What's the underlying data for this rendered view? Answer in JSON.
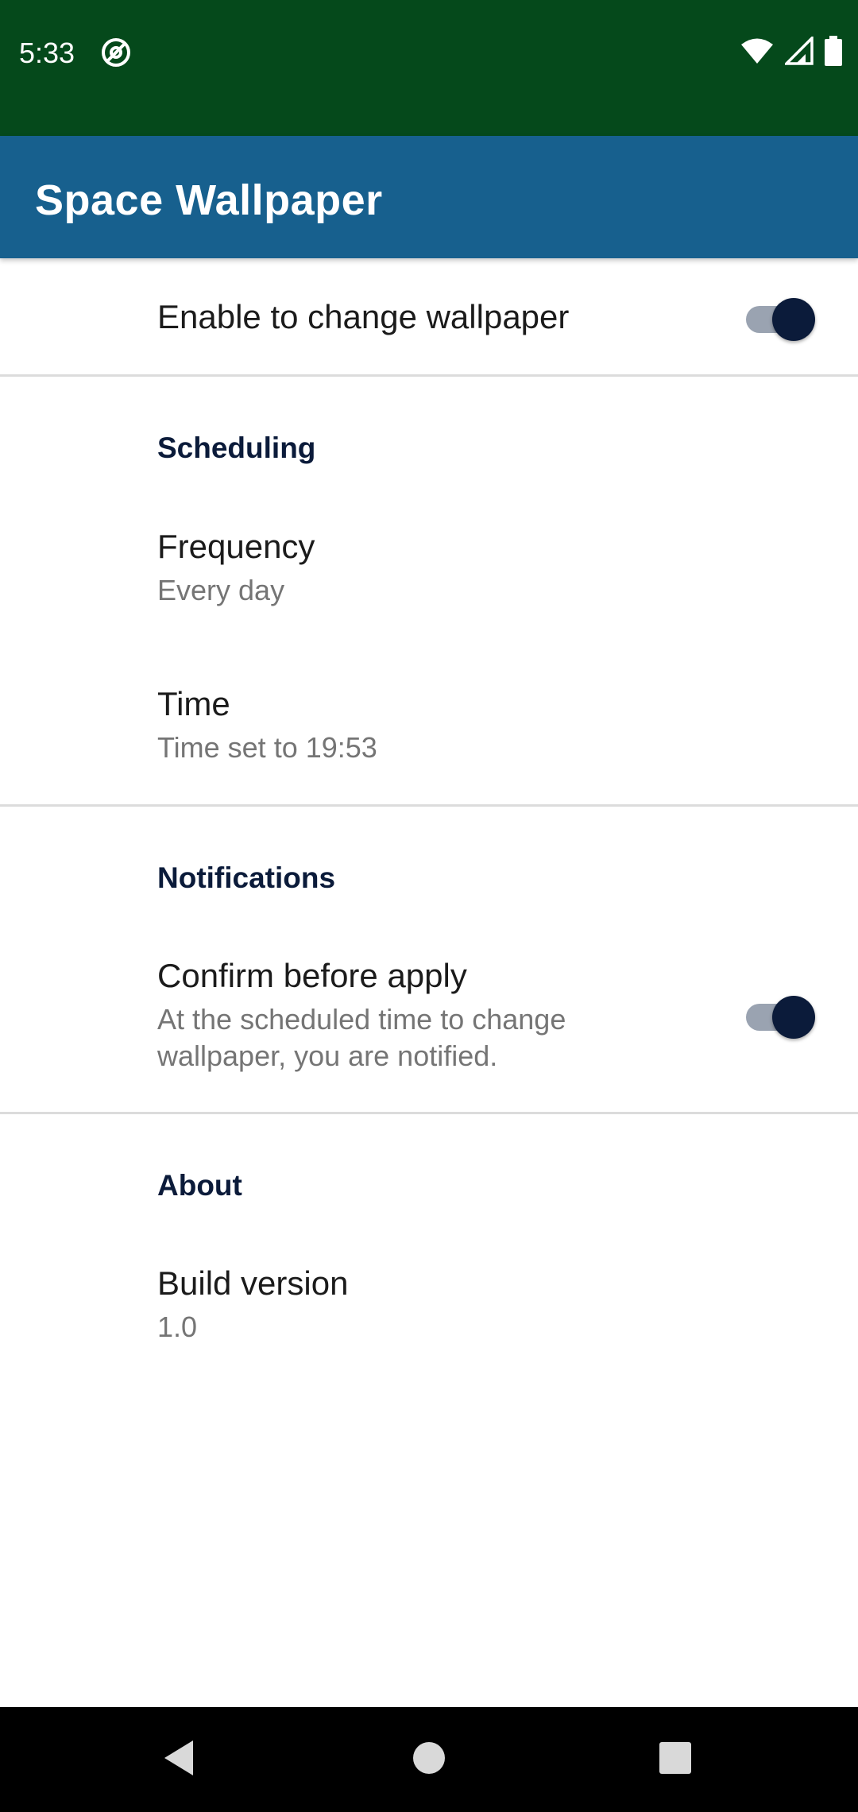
{
  "status_bar": {
    "time": "5:33",
    "icons": [
      "at-sign-icon",
      "wifi-icon",
      "signal-icon",
      "battery-icon"
    ]
  },
  "app_bar": {
    "title": "Space Wallpaper"
  },
  "settings": {
    "enable": {
      "title": "Enable to change wallpaper",
      "checked": true
    },
    "scheduling": {
      "header": "Scheduling",
      "frequency": {
        "title": "Frequency",
        "summary": "Every day"
      },
      "time": {
        "title": "Time",
        "summary": "Time set to 19:53"
      }
    },
    "notifications": {
      "header": "Notifications",
      "confirm": {
        "title": "Confirm before apply",
        "summary_line1": "At the scheduled time to change",
        "summary_line2": "wallpaper, you are notified.",
        "checked": true
      }
    },
    "about": {
      "header": "About",
      "build": {
        "title": "Build version",
        "summary": "1.0"
      }
    }
  },
  "nav_bar": {
    "icons": [
      "back-icon",
      "home-icon",
      "recents-icon"
    ]
  },
  "colors": {
    "status_bar": "#05491b",
    "app_bar": "#17608e",
    "accent": "#0b1b3a",
    "switch_track": "#9aa3b1"
  }
}
